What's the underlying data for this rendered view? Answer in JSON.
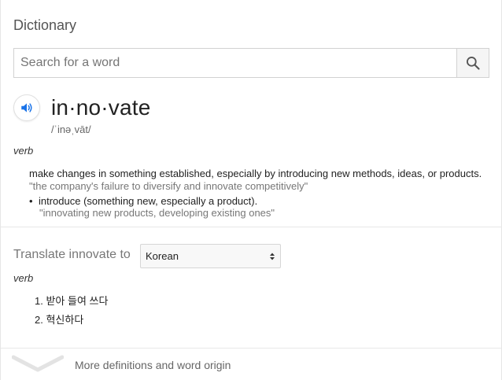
{
  "header": {
    "title": "Dictionary"
  },
  "search": {
    "placeholder": "Search for a word",
    "value": "",
    "button_icon": "search-icon"
  },
  "entry": {
    "pronounce_icon": "speaker-icon",
    "headword": "in·no·vate",
    "phonetic": "/ˈinəˌvāt/",
    "part_of_speech": "verb",
    "definitions": [
      {
        "text": "make changes in something established, especially by introducing new methods, ideas, or products.",
        "example": "\"the company's failure to diversify and innovate competitively\"",
        "sub_definitions": [
          {
            "bullet": "•",
            "text": "introduce (something new, especially a product).",
            "example": "\"innovating new products, developing existing ones\""
          }
        ]
      }
    ]
  },
  "translate": {
    "label": "Translate innovate to",
    "selected_language": "Korean",
    "part_of_speech": "verb",
    "items": [
      {
        "num": "1.",
        "text": "받아 들여 쓰다"
      },
      {
        "num": "2.",
        "text": "혁신하다"
      }
    ]
  },
  "footer": {
    "more_label": "More definitions and word origin",
    "chevron_icon": "chevron-down-icon"
  },
  "colors": {
    "accent_blue": "#1a73e8",
    "text_primary": "#222222",
    "text_secondary": "#777777",
    "border": "#d2d2d2"
  }
}
